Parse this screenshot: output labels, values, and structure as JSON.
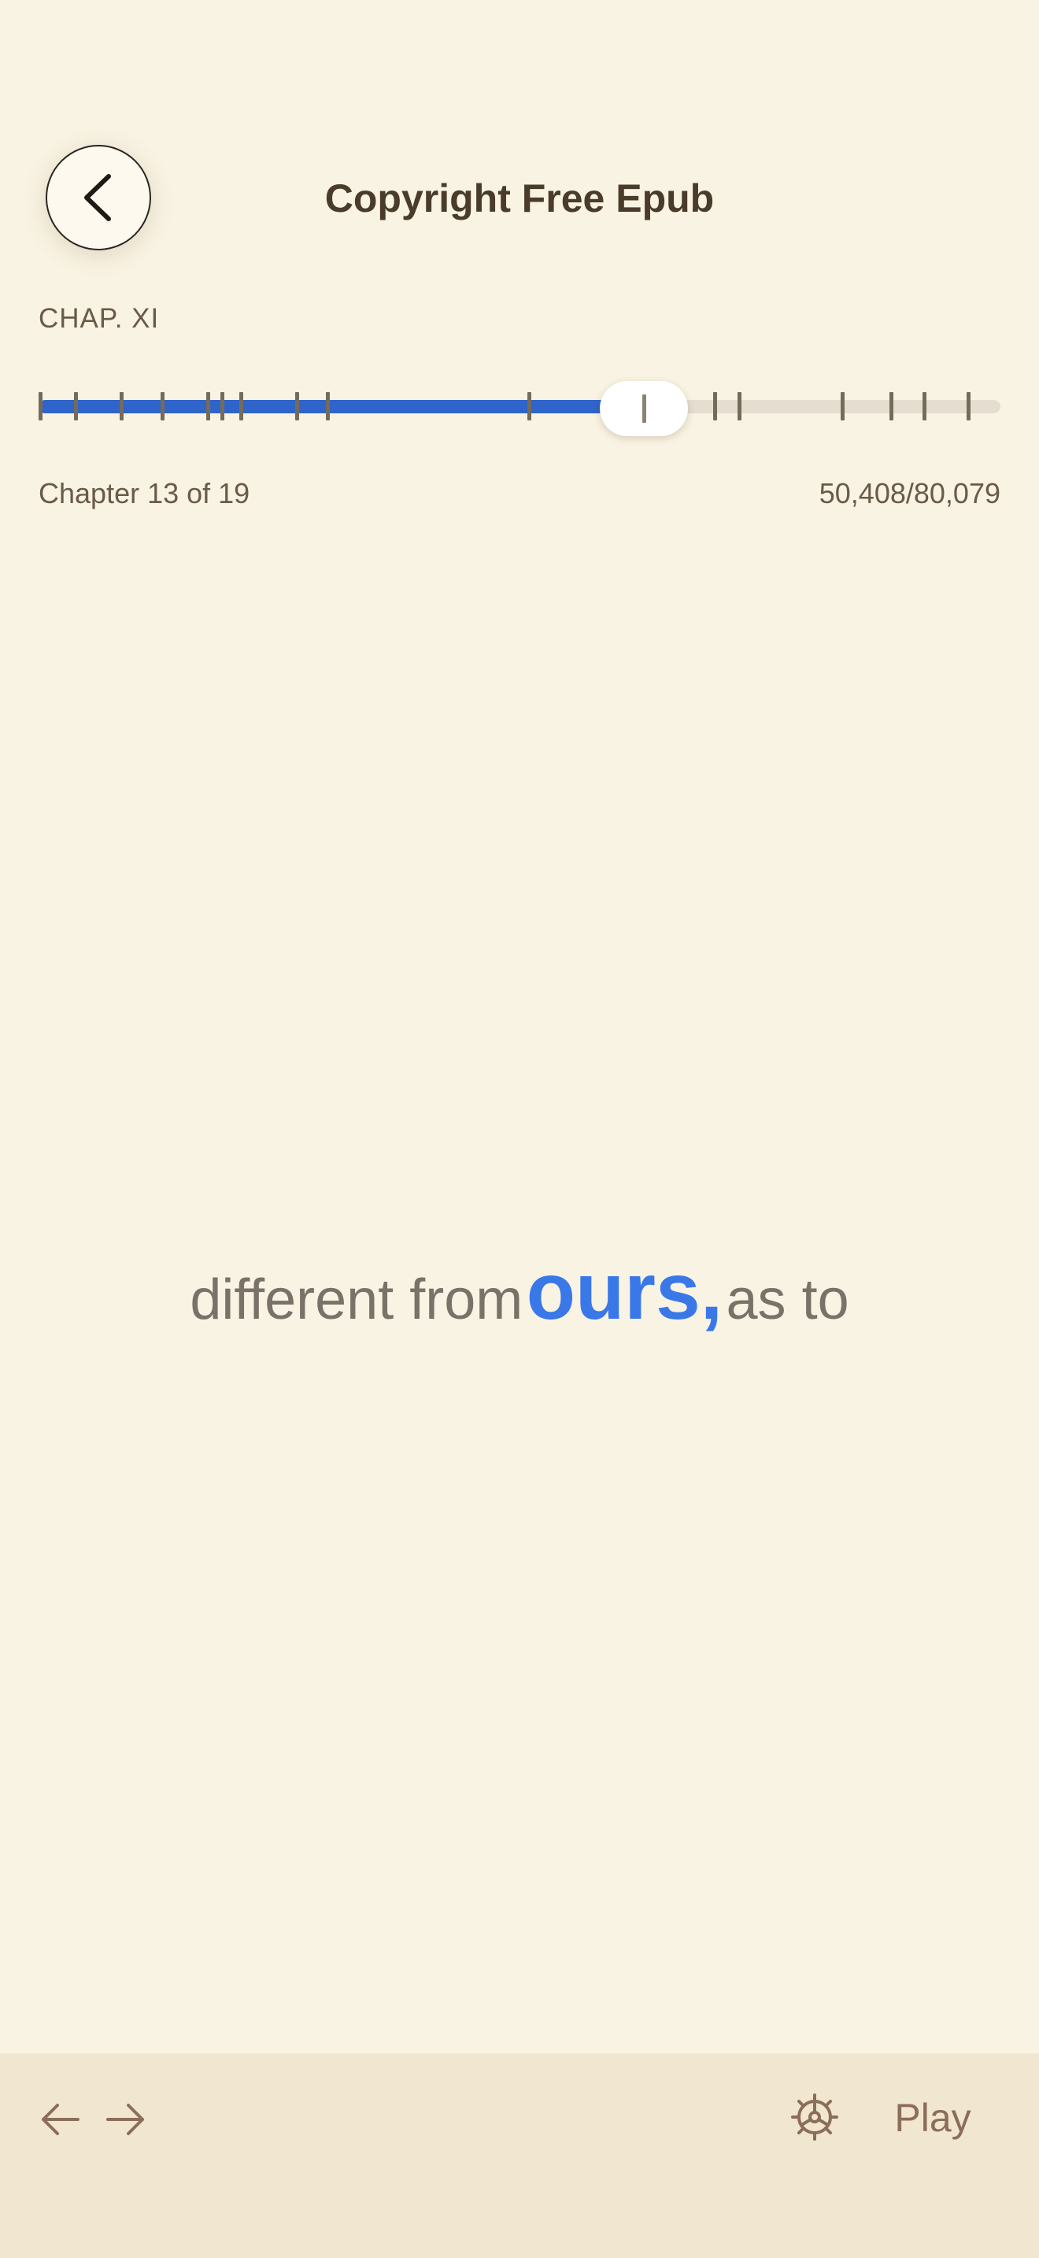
{
  "header": {
    "back_icon": "chevron-left-icon",
    "title": "Copyright Free Epub"
  },
  "progress": {
    "chapter_label": "CHAP. XI",
    "chapter_count_text": "Chapter 13 of 19",
    "word_count_text": "50,408/80,079",
    "fraction": 0.6295,
    "chapter_marks": [
      0.0,
      0.037,
      0.084,
      0.127,
      0.174,
      0.189,
      0.209,
      0.267,
      0.299,
      0.508,
      0.701,
      0.727,
      0.834,
      0.885,
      0.919,
      0.965
    ],
    "fill_color": "#2F64CB",
    "track_color": "#E5DED0"
  },
  "reader": {
    "before": "different from",
    "current": "ours,",
    "after": "as to",
    "highlight_color": "#3A78E8"
  },
  "bottom_bar": {
    "prev_icon": "arrow-left-icon",
    "next_icon": "arrow-right-icon",
    "settings_icon": "gear-icon",
    "play_label": "Play"
  },
  "colors": {
    "background": "#F9F3E3",
    "bottom_bar": "#F1E6D0",
    "accent": "#3A78E8"
  }
}
